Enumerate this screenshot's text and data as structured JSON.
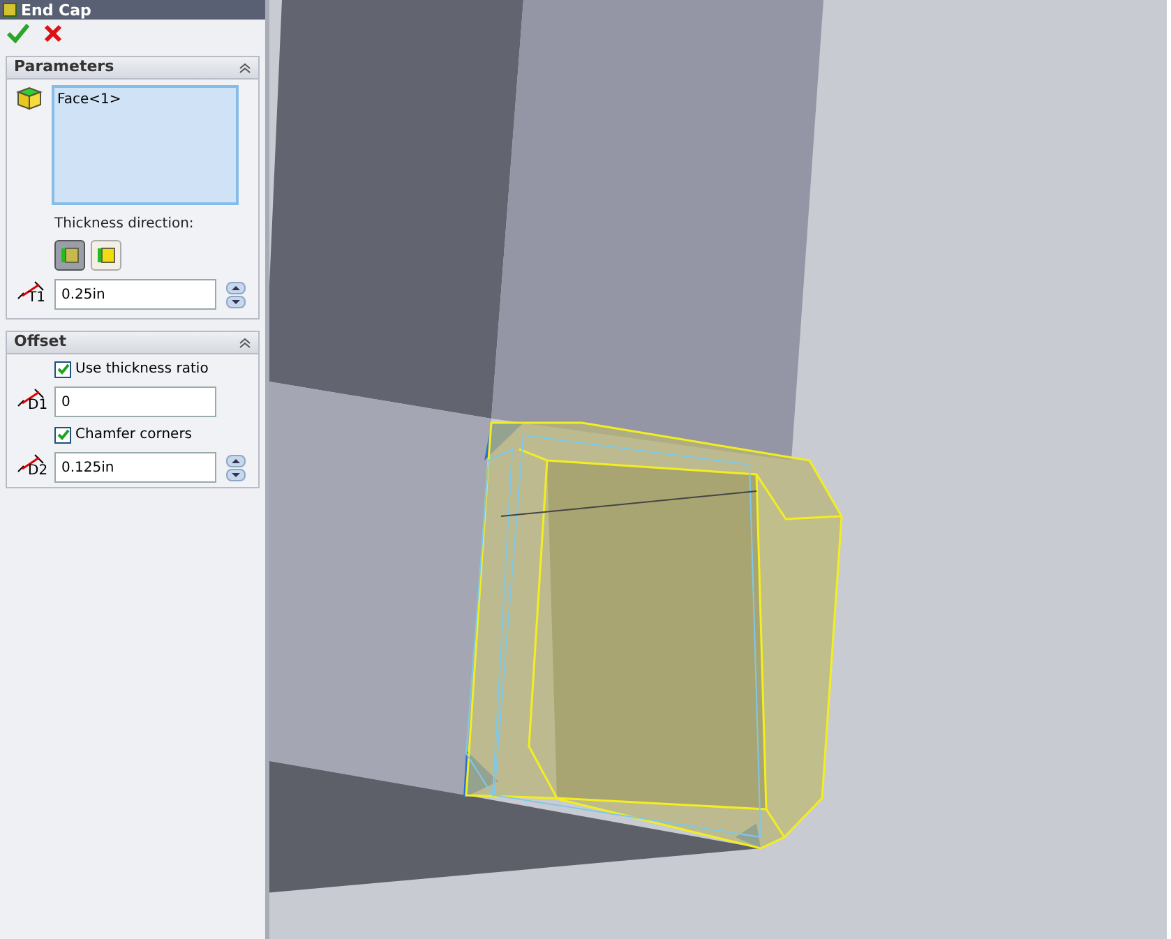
{
  "window": {
    "title": "End Cap"
  },
  "actions": [
    {
      "kind": "ok"
    },
    {
      "kind": "cancel"
    }
  ],
  "parameters": {
    "title": "Parameters",
    "expanded": true,
    "selection": [
      "Face<1>"
    ],
    "direction_label": "Thickness direction:",
    "directions": [
      {
        "kind": "inward",
        "selected": true
      },
      {
        "kind": "outward",
        "selected": false
      }
    ],
    "thickness": {
      "icon_label": "T1",
      "value": "0.25in"
    }
  },
  "offset": {
    "title": "Offset",
    "expanded": true,
    "rows": [
      {
        "kind": "checkbox",
        "label": "Use thickness ratio",
        "checked": true
      },
      {
        "kind": "field",
        "icon_label": "D1",
        "value": "0",
        "spinner": false
      },
      {
        "kind": "checkbox",
        "label": "Chamfer corners",
        "checked": true
      },
      {
        "kind": "field",
        "icon_label": "D2",
        "value": "0.125in",
        "spinner": true
      }
    ]
  }
}
